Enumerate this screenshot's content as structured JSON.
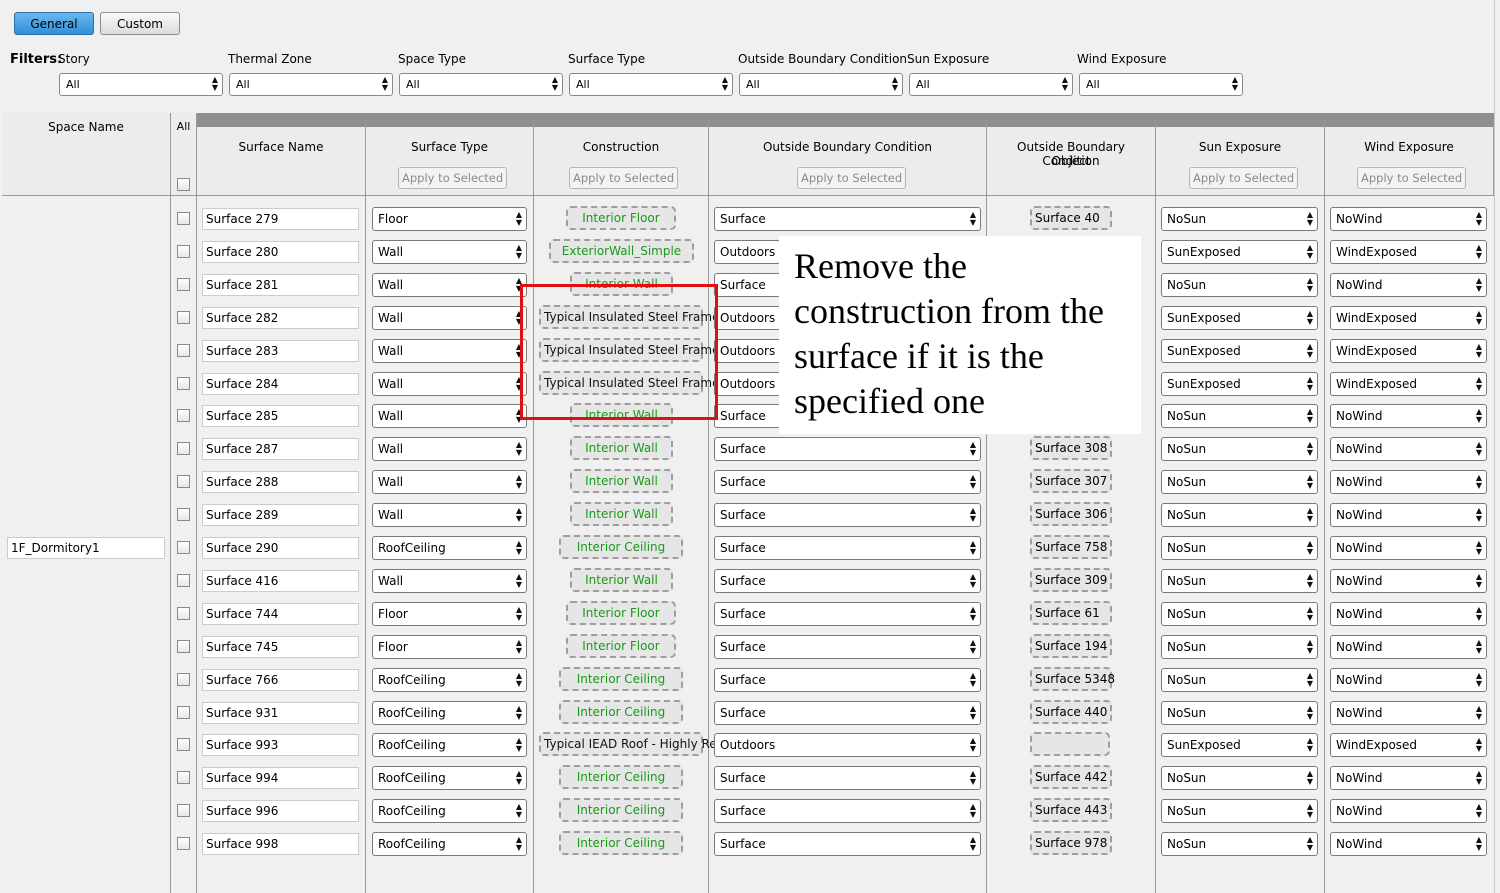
{
  "tabs": {
    "general": "General",
    "custom": "Custom"
  },
  "filters": {
    "label": "Filters:",
    "items": [
      {
        "label": "Story",
        "value": "All"
      },
      {
        "label": "Thermal Zone",
        "value": "All"
      },
      {
        "label": "Space Type",
        "value": "All"
      },
      {
        "label": "Surface Type",
        "value": "All"
      },
      {
        "label": "Outside Boundary Condition",
        "value": "All"
      },
      {
        "label": "Sun Exposure",
        "value": "All"
      },
      {
        "label": "Wind Exposure",
        "value": "All"
      }
    ]
  },
  "columns": {
    "space_name": "Space Name",
    "all": "All",
    "surface_name": "Surface Name",
    "surface_type": "Surface Type",
    "construction": "Construction",
    "obc": "Outside Boundary Condition",
    "obc_object_1": "Outside Boundary Condition",
    "obc_object_2": "Object",
    "sun": "Sun Exposure",
    "wind": "Wind Exposure",
    "apply": "Apply to Selected"
  },
  "space": "1F_Dormitory1",
  "rows": [
    {
      "name": "Surface 279",
      "type": "Floor",
      "cons": "Interior Floor",
      "cc": "green",
      "obc": "Surface",
      "obj": "Surface 40",
      "sun": "NoSun",
      "wind": "NoWind"
    },
    {
      "name": "Surface 280",
      "type": "Wall",
      "cons": "ExteriorWall_Simple",
      "cc": "green",
      "obc": "Outdoors",
      "obj": "",
      "sun": "SunExposed",
      "wind": "WindExposed"
    },
    {
      "name": "Surface 281",
      "type": "Wall",
      "cons": "Interior Wall",
      "cc": "green",
      "obc": "Surface",
      "obj": "",
      "sun": "NoSun",
      "wind": "NoWind"
    },
    {
      "name": "Surface 282",
      "type": "Wall",
      "cons": "Typical Insulated Steel Frame",
      "cc": "black",
      "obc": "Outdoors",
      "obj": "",
      "sun": "SunExposed",
      "wind": "WindExposed"
    },
    {
      "name": "Surface 283",
      "type": "Wall",
      "cons": "Typical Insulated Steel Frame",
      "cc": "black",
      "obc": "Outdoors",
      "obj": "",
      "sun": "SunExposed",
      "wind": "WindExposed"
    },
    {
      "name": "Surface 284",
      "type": "Wall",
      "cons": "Typical Insulated Steel Frame",
      "cc": "black",
      "obc": "Outdoors",
      "obj": "",
      "sun": "SunExposed",
      "wind": "WindExposed"
    },
    {
      "name": "Surface 285",
      "type": "Wall",
      "cons": "Interior Wall",
      "cc": "green",
      "obc": "Surface",
      "obj": "",
      "sun": "NoSun",
      "wind": "NoWind"
    },
    {
      "name": "Surface 287",
      "type": "Wall",
      "cons": "Interior Wall",
      "cc": "green",
      "obc": "Surface",
      "obj": "Surface 308",
      "sun": "NoSun",
      "wind": "NoWind"
    },
    {
      "name": "Surface 288",
      "type": "Wall",
      "cons": "Interior Wall",
      "cc": "green",
      "obc": "Surface",
      "obj": "Surface 307",
      "sun": "NoSun",
      "wind": "NoWind"
    },
    {
      "name": "Surface 289",
      "type": "Wall",
      "cons": "Interior Wall",
      "cc": "green",
      "obc": "Surface",
      "obj": "Surface 306",
      "sun": "NoSun",
      "wind": "NoWind"
    },
    {
      "name": "Surface 290",
      "type": "RoofCeiling",
      "cons": "Interior Ceiling",
      "cc": "green",
      "obc": "Surface",
      "obj": "Surface 758",
      "sun": "NoSun",
      "wind": "NoWind"
    },
    {
      "name": "Surface 416",
      "type": "Wall",
      "cons": "Interior Wall",
      "cc": "green",
      "obc": "Surface",
      "obj": "Surface 309",
      "sun": "NoSun",
      "wind": "NoWind"
    },
    {
      "name": "Surface 744",
      "type": "Floor",
      "cons": "Interior Floor",
      "cc": "green",
      "obc": "Surface",
      "obj": "Surface 61",
      "sun": "NoSun",
      "wind": "NoWind"
    },
    {
      "name": "Surface 745",
      "type": "Floor",
      "cons": "Interior Floor",
      "cc": "green",
      "obc": "Surface",
      "obj": "Surface 194",
      "sun": "NoSun",
      "wind": "NoWind"
    },
    {
      "name": "Surface 766",
      "type": "RoofCeiling",
      "cons": "Interior Ceiling",
      "cc": "green",
      "obc": "Surface",
      "obj": "Surface 5348",
      "sun": "NoSun",
      "wind": "NoWind"
    },
    {
      "name": "Surface 931",
      "type": "RoofCeiling",
      "cons": "Interior Ceiling",
      "cc": "green",
      "obc": "Surface",
      "obj": "Surface 440",
      "sun": "NoSun",
      "wind": "NoWind"
    },
    {
      "name": "Surface 993",
      "type": "RoofCeiling",
      "cons": "Typical IEAD Roof - Highly Re",
      "cc": "black",
      "obc": "Outdoors",
      "obj": "",
      "sun": "SunExposed",
      "wind": "WindExposed"
    },
    {
      "name": "Surface 994",
      "type": "RoofCeiling",
      "cons": "Interior Ceiling",
      "cc": "green",
      "obc": "Surface",
      "obj": "Surface 442",
      "sun": "NoSun",
      "wind": "NoWind"
    },
    {
      "name": "Surface 996",
      "type": "RoofCeiling",
      "cons": "Interior Ceiling",
      "cc": "green",
      "obc": "Surface",
      "obj": "Surface 443",
      "sun": "NoSun",
      "wind": "NoWind"
    },
    {
      "name": "Surface 998",
      "type": "RoofCeiling",
      "cons": "Interior Ceiling",
      "cc": "green",
      "obc": "Surface",
      "obj": "Surface 978",
      "sun": "NoSun",
      "wind": "NoWind"
    }
  ],
  "note": "Remove the construction from the surface if it is the specified one",
  "colors": {
    "green_text": "#1a9a1a",
    "red_box": "#e01010",
    "tab_active": "#3a97dd"
  }
}
